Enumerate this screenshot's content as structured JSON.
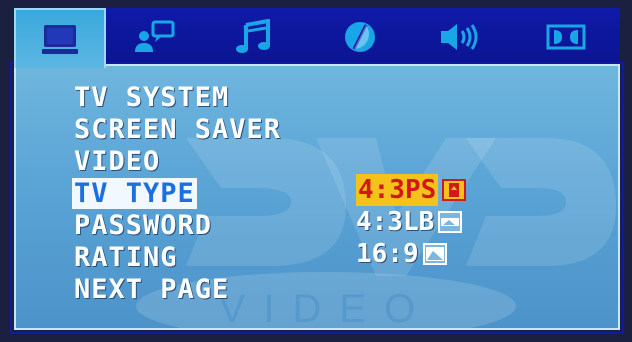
{
  "tabs": [
    {
      "name": "tab-general-setup",
      "icon": "monitor-icon",
      "active": true
    },
    {
      "name": "tab-speaker-setup",
      "icon": "person-speech-icon",
      "active": false
    },
    {
      "name": "tab-audio-setup",
      "icon": "music-note-icon",
      "active": false
    },
    {
      "name": "tab-video-setup",
      "icon": "half-circle-icon",
      "active": false
    },
    {
      "name": "tab-volume-setup",
      "icon": "speaker-volume-icon",
      "active": false
    },
    {
      "name": "tab-dolby-setup",
      "icon": "dolby-icon",
      "active": false
    }
  ],
  "menu": {
    "items": [
      {
        "label": "TV SYSTEM"
      },
      {
        "label": "SCREEN SAVER"
      },
      {
        "label": "VIDEO"
      },
      {
        "label": "TV TYPE",
        "selected": true
      },
      {
        "label": "PASSWORD"
      },
      {
        "label": "RATING"
      },
      {
        "label": "NEXT PAGE"
      }
    ]
  },
  "options": {
    "items": [
      {
        "label": "4:3PS",
        "icon": "pan-scan-icon",
        "selected": true
      },
      {
        "label": "4:3LB",
        "icon": "letterbox-icon"
      },
      {
        "label": "16:9",
        "icon": "widescreen-icon"
      }
    ]
  },
  "watermark": {
    "logo_text": "DVD",
    "sub_text": "VIDEO"
  },
  "colors": {
    "tabbar_bg": "#0f1aa8",
    "tab_icon": "#19a6e6",
    "panel_bg": "#5aa4d6",
    "menu_text": "#ffffff",
    "menu_selected_text": "#1b6fe0",
    "option_selected_bg": "#f4c21a",
    "option_selected_text": "#d2181a"
  }
}
